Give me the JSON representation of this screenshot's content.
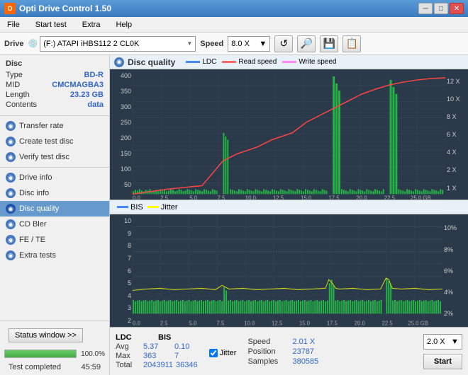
{
  "titleBar": {
    "title": "Opti Drive Control 1.50",
    "iconText": "O",
    "minimizeLabel": "─",
    "maximizeLabel": "□",
    "closeLabel": "✕"
  },
  "menuBar": {
    "items": [
      "File",
      "Start test",
      "Extra",
      "Help"
    ]
  },
  "toolbar": {
    "driveLabel": "Drive",
    "driveValue": "(F:)  ATAPI iHBS112  2 CL0K",
    "speedLabel": "Speed",
    "speedValue": "8.0 X",
    "icons": [
      "↺",
      "🔍",
      "💾",
      "💾"
    ]
  },
  "sidebar": {
    "discSection": {
      "title": "Disc",
      "rows": [
        {
          "key": "Type",
          "value": "BD-R"
        },
        {
          "key": "MID",
          "value": "CMCMAGBA3"
        },
        {
          "key": "Length",
          "value": "23.23 GB"
        },
        {
          "key": "Contents",
          "value": "data"
        }
      ]
    },
    "buttons": [
      {
        "id": "transfer-rate",
        "label": "Transfer rate",
        "active": false
      },
      {
        "id": "create-test-disc",
        "label": "Create test disc",
        "active": false
      },
      {
        "id": "verify-test-disc",
        "label": "Verify test disc",
        "active": false
      },
      {
        "id": "drive-info",
        "label": "Drive info",
        "active": false
      },
      {
        "id": "disc-info",
        "label": "Disc info",
        "active": false
      },
      {
        "id": "disc-quality",
        "label": "Disc quality",
        "active": true
      },
      {
        "id": "cd-bler",
        "label": "CD Bler",
        "active": false
      },
      {
        "id": "fe-te",
        "label": "FE / TE",
        "active": false
      },
      {
        "id": "extra-tests",
        "label": "Extra tests",
        "active": false
      }
    ],
    "statusButton": "Status window >>",
    "progressPercent": 100,
    "progressText": "100.0%",
    "statusText": "Test completed",
    "timeText": "45:59"
  },
  "topChart": {
    "title": "Disc quality",
    "iconChar": "◉",
    "legend": [
      {
        "label": "LDC",
        "color": "#4488ff"
      },
      {
        "label": "Read speed",
        "color": "#ff6666"
      },
      {
        "label": "Write speed",
        "color": "#ff88ff"
      }
    ],
    "yAxisMax": 400,
    "yAxisLabels": [
      "400",
      "350",
      "300",
      "250",
      "200",
      "150",
      "100",
      "50"
    ],
    "yAxisRight": [
      "12 X",
      "10 X",
      "8 X",
      "6 X",
      "4 X",
      "2 X",
      "1 X"
    ],
    "xAxisLabels": [
      "0.0",
      "2.5",
      "5.0",
      "7.5",
      "10.0",
      "12.5",
      "15.0",
      "17.5",
      "20.0",
      "22.5",
      "25.0 GB"
    ]
  },
  "bottomChart": {
    "legend": [
      {
        "label": "BIS",
        "color": "#4488ff"
      },
      {
        "label": "Jitter",
        "color": "#ffff00"
      }
    ],
    "yAxisMax": 10,
    "yAxisLabels": [
      "10",
      "9",
      "8",
      "7",
      "6",
      "5",
      "4",
      "3",
      "2"
    ],
    "yAxisRight": [
      "10%",
      "8%",
      "6%",
      "4%",
      "2%"
    ],
    "xAxisLabels": [
      "0.0",
      "2.5",
      "5.0",
      "7.5",
      "10.0",
      "12.5",
      "15.0",
      "17.5",
      "20.0",
      "22.5",
      "25.0 GB"
    ]
  },
  "statsBar": {
    "columns": [
      {
        "header": "LDC",
        "rows": [
          {
            "label": "Avg",
            "value": "5.37"
          },
          {
            "label": "Max",
            "value": "363"
          },
          {
            "label": "Total",
            "value": "2043911"
          }
        ]
      },
      {
        "header": "BIS",
        "rows": [
          {
            "label": "",
            "value": "0.10"
          },
          {
            "label": "",
            "value": "7"
          },
          {
            "label": "",
            "value": "36346"
          }
        ]
      }
    ],
    "jitterLabel": "Jitter",
    "speedLabel": "Speed",
    "speedValue": "2.01 X",
    "speedSelect": "2.0 X",
    "positionLabel": "Position",
    "positionValue": "23787",
    "samplesLabel": "Samples",
    "samplesValue": "380585",
    "startButton": "Start"
  }
}
